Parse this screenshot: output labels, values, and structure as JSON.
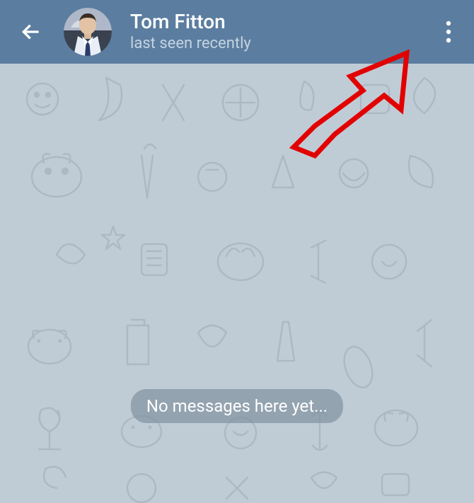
{
  "header": {
    "contact_name": "Tom Fitton",
    "contact_status": "last seen recently"
  },
  "chat": {
    "empty_message": "No messages here yet..."
  },
  "colors": {
    "header_bg": "#5b7da0",
    "chat_bg": "#c0ccd5",
    "annotation": "#e20000"
  }
}
